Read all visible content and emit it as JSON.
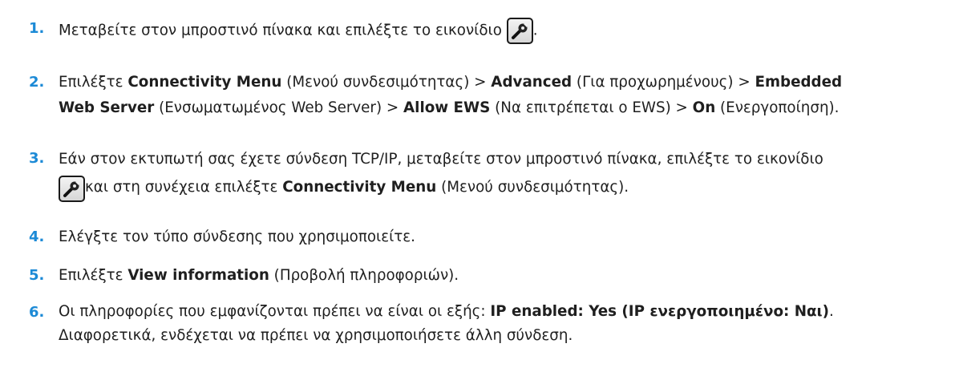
{
  "steps": [
    {
      "number": "1.",
      "icon": "wrench-icon",
      "parts": [
        "Μεταβείτε στον μπροστινό πίνακα και επιλέξτε το εικονίδιο",
        "."
      ]
    },
    {
      "number": "2.",
      "parts": [
        "Επιλέξτε ",
        "Connectivity Menu",
        " (Μενού συνδεσιμότητας) > ",
        "Advanced",
        " (Για προχωρημένους) > ",
        "Embedded",
        "Web Server",
        " (Ενσωματωμένος Web Server) > ",
        "Allow EWS",
        " (Να επιτρέπεται ο EWS) > ",
        "On",
        " (Ενεργοποίηση)."
      ]
    },
    {
      "number": "3.",
      "icon": "wrench-icon",
      "parts": [
        "Εάν στον εκτυπωτή σας έχετε σύνδεση TCP/IP, μεταβείτε στον μπροστινό πίνακα, επιλέξτε το εικονίδιο",
        "και στη συνέχεια επιλέξτε ",
        "Connectivity Menu",
        " (Μενού συνδεσιμότητας)."
      ]
    },
    {
      "number": "4.",
      "parts": [
        "Ελέγξτε τον τύπο σύνδεσης που χρησιμοποιείτε."
      ]
    },
    {
      "number": "5.",
      "parts": [
        "Επιλέξτε ",
        "View information",
        " (Προβολή πληροφοριών)."
      ]
    },
    {
      "number": "6.",
      "parts": [
        "Οι πληροφορίες που εμφανίζονται πρέπει να είναι οι εξής: ",
        "IP enabled: Yes (IP ενεργοποιημένο: Ναι)",
        ".",
        "Διαφορετικά, ενδέχεται να πρέπει να χρησιμοποιήσετε άλλη σύνδεση."
      ]
    }
  ],
  "colors": {
    "step_number": "#1c8ad6",
    "text": "#1f1f1f"
  }
}
